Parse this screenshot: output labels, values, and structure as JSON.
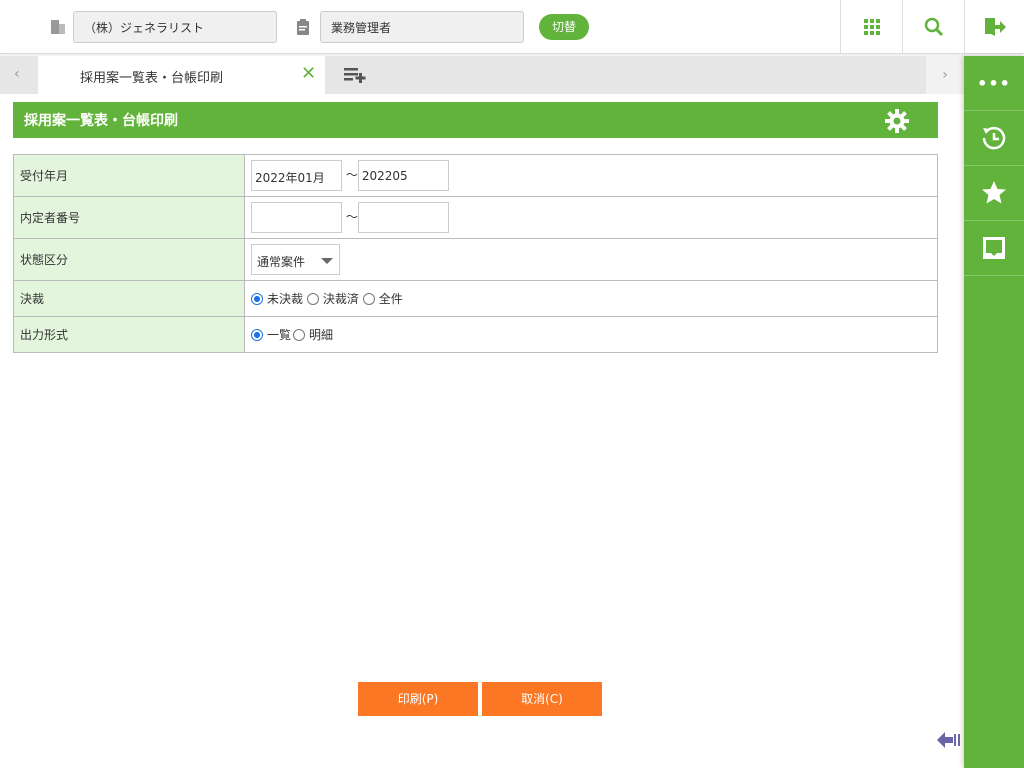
{
  "header": {
    "company": "（株）ジェネラリスト",
    "role": "業務管理者",
    "switch_label": "切替"
  },
  "tabs": [
    {
      "label": "採用案一覧表・台帳印刷"
    }
  ],
  "page": {
    "title": "採用案一覧表・台帳印刷"
  },
  "form": {
    "rows": [
      {
        "label": "受付年月",
        "from": "2022年01月",
        "to": "202205",
        "sep": "～"
      },
      {
        "label": "内定者番号",
        "from": "",
        "to": "",
        "sep": "～"
      },
      {
        "label": "状態区分",
        "value": "通常案件"
      },
      {
        "label": "決裁",
        "options": [
          "未決裁",
          "決裁済",
          "全件"
        ],
        "selected": 0
      },
      {
        "label": "出力形式",
        "options": [
          "一覧",
          "明細"
        ],
        "selected": 0
      }
    ]
  },
  "buttons": {
    "print": "印刷(P)",
    "cancel": "取消(C)"
  },
  "colors": {
    "brand": "#62b33b",
    "action": "#fb7723"
  }
}
